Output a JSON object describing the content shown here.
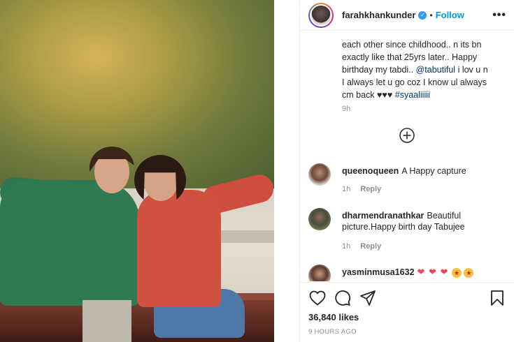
{
  "post": {
    "username": "farahkhankunder",
    "verified_glyph": "✓",
    "separator": "•",
    "follow_label": "Follow",
    "more_label": "•••",
    "caption": {
      "line1": "each other since childhood.. n its bn",
      "line2": "exactly like that 25yrs later.. Happy",
      "line3_prefix": "birthday my tabdi.. ",
      "mention": "@tabutiful",
      "line3_suffix": " i lov u n",
      "line4": "I always let u go coz I know ul always",
      "line5_prefix": "cm back ♥♥♥ ",
      "hashtag": "#syaaliiiii"
    },
    "caption_time": "9h",
    "likes": "36,840 likes",
    "posted_ago": "9 HOURS AGO"
  },
  "comments": [
    {
      "username": "queenoqueen",
      "text": "A Happy capture",
      "time": "1h",
      "reply": "Reply"
    },
    {
      "username": "dharmendranathkar",
      "text": "Beautiful picture.Happy birth day Tabujee",
      "time": "1h",
      "reply": "Reply"
    },
    {
      "username": "yasminmusa1632",
      "text": ""
    }
  ],
  "colors": {
    "link": "#00376b",
    "follow": "#0095f6",
    "verified": "#3897f0",
    "muted": "#8e8e8e"
  },
  "icons": [
    "verified-icon",
    "more-options-icon",
    "load-more-icon",
    "heart-icon",
    "comment-icon",
    "share-icon",
    "bookmark-icon",
    "heart-emoji-icon",
    "star-eyes-emoji-icon"
  ]
}
